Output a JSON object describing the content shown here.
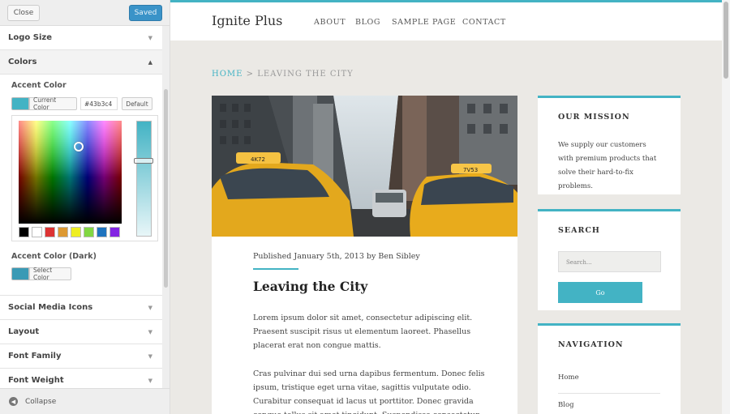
{
  "customizer": {
    "close_label": "Close",
    "saved_label": "Saved",
    "sections": [
      {
        "label": "Logo Size"
      },
      {
        "label": "Colors"
      },
      {
        "label": "Social Media Icons"
      },
      {
        "label": "Layout"
      },
      {
        "label": "Font Family"
      },
      {
        "label": "Font Weight"
      }
    ],
    "accent_label": "Accent Color",
    "current_color_label": "Current Color",
    "hex_value": "#43b3c4",
    "default_label": "Default",
    "accent_dark_label": "Accent Color (Dark)",
    "select_color_label": "Select Color",
    "collapse_label": "Collapse",
    "palette": [
      "#000000",
      "#ffffff",
      "#dd3333",
      "#dd9933",
      "#eeee22",
      "#81d742",
      "#1e73be",
      "#8224e3"
    ],
    "accent_color": "#43b3c4",
    "accent_dark_color": "#3a9ab5"
  },
  "site": {
    "title": "Ignite Plus",
    "nav": [
      "ABOUT",
      "BLOG",
      "SAMPLE PAGE",
      "CONTACT"
    ],
    "breadcrumb_home": "HOME",
    "breadcrumb_sep": ">",
    "breadcrumb_current": "LEAVING THE CITY",
    "post": {
      "meta": "Published January 5th, 2013 by Ben Sibley",
      "title": "Leaving the City",
      "para1": "Lorem ipsum dolor sit amet, consectetur adipiscing elit. Praesent suscipit risus ut elementum laoreet. Phasellus placerat erat non congue mattis.",
      "para2": "Cras pulvinar dui sed urna dapibus fermentum. Donec felis ipsum, tristique eget urna vitae, sagittis vulputate odio. Curabitur consequat id lacus ut porttitor. Donec gravida congue tellus sit amet tincidunt. Suspendisse consectetur",
      "taxi_plate_left": "4K72",
      "taxi_plate_right": "7V53"
    },
    "widgets": {
      "mission_title": "OUR MISSION",
      "mission_text": "We supply our customers with premium products that solve their hard-to-fix problems.",
      "search_title": "SEARCH",
      "search_placeholder": "Search...",
      "search_button": "Go",
      "navigation_title": "NAVIGATION",
      "nav_items": [
        "Home",
        "Blog"
      ]
    }
  }
}
